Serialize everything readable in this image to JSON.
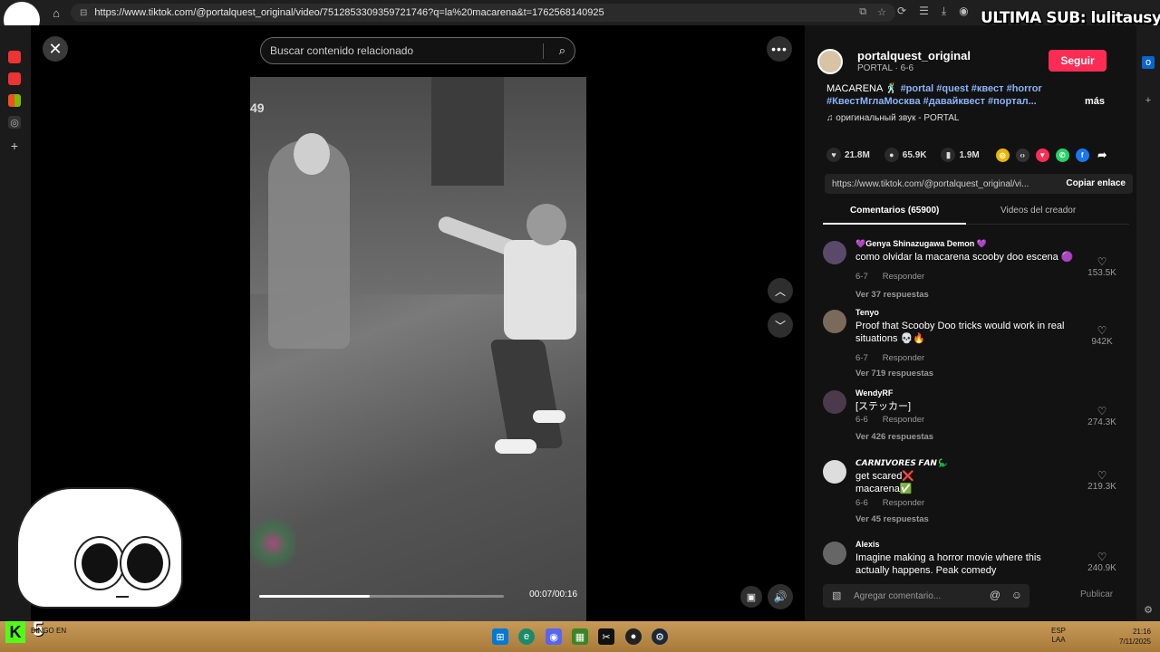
{
  "browser": {
    "url": "https://www.tiktok.com/@portalquest_original/video/7512853309359721746?q=la%20macarena&t=1762568140925",
    "overlay_text": "ULTIMA SUB: lulitausycita"
  },
  "search": {
    "placeholder": "Buscar contenido relacionado"
  },
  "player": {
    "timestamp_overlay": "49",
    "time_display": "00:07/00:16",
    "progress": 0.45
  },
  "author": {
    "username": "portalquest_original",
    "subtitle": "PORTAL · 6-6",
    "follow_label": "Seguir"
  },
  "caption": {
    "text": "MACARENA 🕺",
    "hashtags_line1": "#portal #quest #квест #horror",
    "hashtags_line2": "#КвестМглаМосква #давайквест #портал...",
    "more_label": "más",
    "sound": "оригинальный звук - PORTAL"
  },
  "stats": {
    "likes": "21.8M",
    "comments": "65.9K",
    "saves": "1.9M"
  },
  "link": {
    "url": "https://www.tiktok.com/@portalquest_original/vi...",
    "copy_label": "Copiar enlace"
  },
  "tabs": {
    "comments": "Comentarios (65900)",
    "creator_videos": "Videos del creador"
  },
  "comments": [
    {
      "user": "💜Genya Shinazugawa Demon 💜",
      "text": "como olvidar la macarena scooby doo escena 🟣",
      "date": "6-7",
      "reply": "Responder",
      "replies": "Ver 37 respuestas",
      "likes": "153.5K"
    },
    {
      "user": "Tenyo",
      "text": "Proof that Scooby Doo tricks would work in real situations 💀🔥",
      "date": "6-7",
      "reply": "Responder",
      "replies": "Ver 719 respuestas",
      "likes": "942K"
    },
    {
      "user": "WendyRF",
      "text": "[ステッカー]",
      "date": "6-6",
      "reply": "Responder",
      "replies": "Ver 426 respuestas",
      "likes": "274.3K"
    },
    {
      "user": "𝘾𝘼𝙍𝙉𝙄𝙑𝙊𝙍𝙀𝙎 𝙁𝘼𝙉🦕",
      "text_line1": "get scared❌",
      "text_line2": "macarena✅",
      "date": "6-6",
      "reply": "Responder",
      "replies": "Ver 45 respuestas",
      "likes": "219.3K"
    },
    {
      "user": "Alexis",
      "text": "Imagine making a horror movie where this actually happens. Peak comedy",
      "likes": "240.9K"
    }
  ],
  "comment_input": {
    "placeholder": "Agregar comentario...",
    "publish_label": "Publicar"
  },
  "taskbar": {
    "bingo_label": "BINGO EN",
    "lang_line1": "ESP",
    "lang_line2": "LAA",
    "time": "21:16",
    "date": "7/11/2025"
  },
  "colors": {
    "follow": "#fe2c55",
    "hashtag": "#8ab4f8",
    "panel_bg": "#121212"
  }
}
